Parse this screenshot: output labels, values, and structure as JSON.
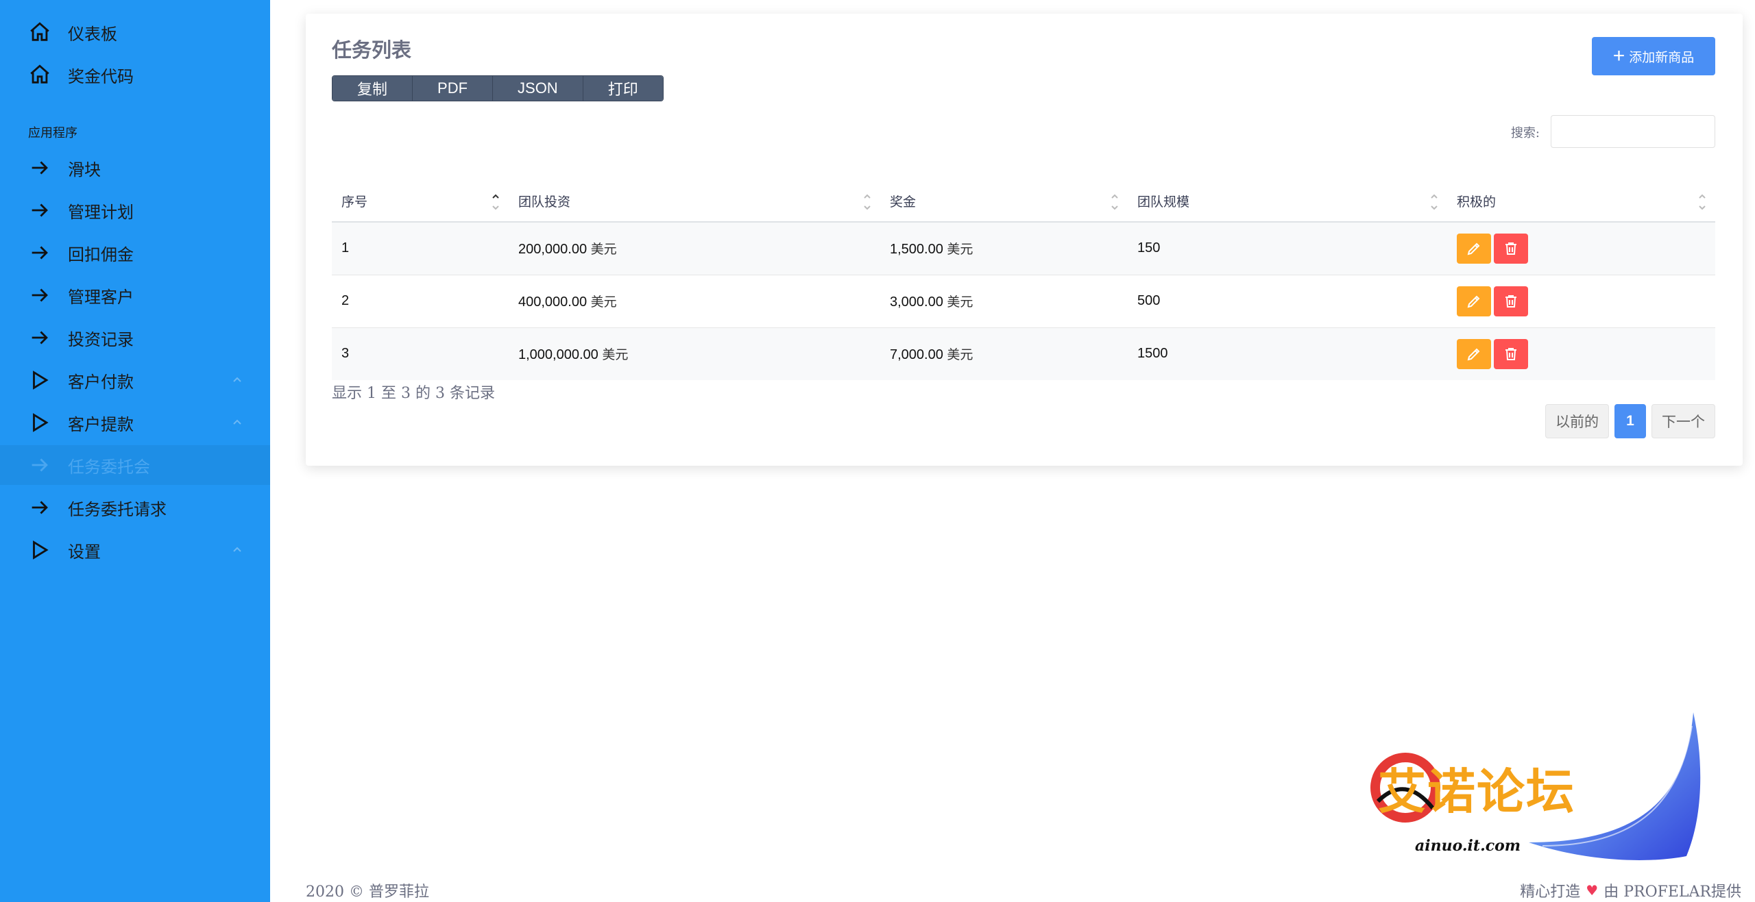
{
  "sidebar": {
    "section_label": "应用程序",
    "items": [
      {
        "label": "仪表板",
        "icon": "home-icon"
      },
      {
        "label": "奖金代码",
        "icon": "home-icon"
      },
      {
        "label": "滑块",
        "icon": "arrow-right-icon"
      },
      {
        "label": "管理计划",
        "icon": "arrow-right-icon"
      },
      {
        "label": "回扣佣金",
        "icon": "arrow-right-icon"
      },
      {
        "label": "管理客户",
        "icon": "arrow-right-icon"
      },
      {
        "label": "投资记录",
        "icon": "arrow-right-icon"
      },
      {
        "label": "客户付款",
        "icon": "play-icon"
      },
      {
        "label": "客户提款",
        "icon": "play-icon"
      },
      {
        "label": "任务委托会",
        "icon": "arrow-right-icon"
      },
      {
        "label": "任务委托请求",
        "icon": "arrow-right-icon"
      },
      {
        "label": "设置",
        "icon": "play-icon"
      }
    ]
  },
  "card": {
    "title": "任务列表",
    "add_button": "添加新商品",
    "export_buttons": [
      "复制",
      "PDF",
      "JSON",
      "打印"
    ],
    "search_label": "搜索:",
    "search_value": ""
  },
  "table": {
    "columns": [
      "序号",
      "团队投资",
      "奖金",
      "团队规模",
      "积极的"
    ],
    "rows": [
      {
        "id": "1",
        "investment": "200,000.00",
        "bonus": "1,500.00",
        "size": "150"
      },
      {
        "id": "2",
        "investment": "400,000.00",
        "bonus": "3,000.00",
        "size": "500"
      },
      {
        "id": "3",
        "investment": "1,000,000.00",
        "bonus": "7,000.00",
        "size": "1500"
      }
    ],
    "currency_unit": "美元",
    "info": "显示 1 至 3 的 3 条记录"
  },
  "pagination": {
    "prev": "以前的",
    "current": "1",
    "next": "下一个"
  },
  "footer": {
    "copyright": "2020 © 普罗菲拉",
    "made_with": "精心打造",
    "by": "由 PROFELAR提供"
  },
  "watermark": {
    "text": "艾诺论坛",
    "url": "ainuo.it.com"
  },
  "colors": {
    "sidebar_bg": "#2196f3",
    "primary": "#4a8ff5",
    "edit": "#ffa726",
    "delete": "#ff5252",
    "export_bg": "#4e5d74"
  }
}
